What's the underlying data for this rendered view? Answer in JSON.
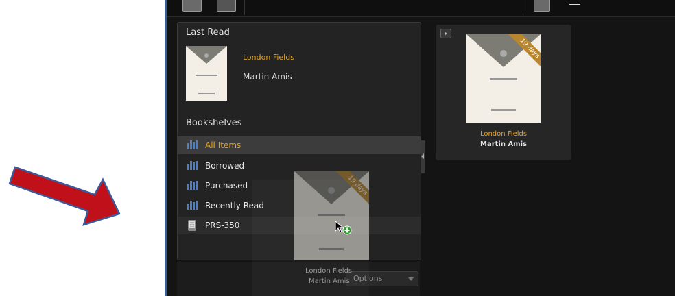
{
  "left_panel": {
    "last_read_heading": "Last Read",
    "last_read_book": {
      "title": "London Fields",
      "author": "Martin Amis"
    },
    "bookshelves_heading": "Bookshelves",
    "shelves": [
      {
        "label": "All Items",
        "icon": "bookshelf-icon",
        "selected": true
      },
      {
        "label": "Borrowed",
        "icon": "bookshelf-icon",
        "selected": false
      },
      {
        "label": "Purchased",
        "icon": "bookshelf-icon",
        "selected": false
      },
      {
        "label": "Recently Read",
        "icon": "bookshelf-icon",
        "selected": false
      }
    ],
    "device": {
      "label": "PRS-350",
      "icon": "ereader-device-icon"
    }
  },
  "bottom_bar": {
    "options_label": "Options"
  },
  "grid": {
    "books": [
      {
        "title": "London Fields",
        "author": "Martin Amis",
        "loan_ribbon": "19 days"
      }
    ]
  },
  "drag_ghost": {
    "title": "London Fields",
    "author": "Martin Amis",
    "loan_ribbon": "19 days"
  },
  "colors": {
    "accent": "#e7a21b",
    "annotation_arrow": "#c0111a",
    "arrow_outline": "#3a5a9a"
  }
}
